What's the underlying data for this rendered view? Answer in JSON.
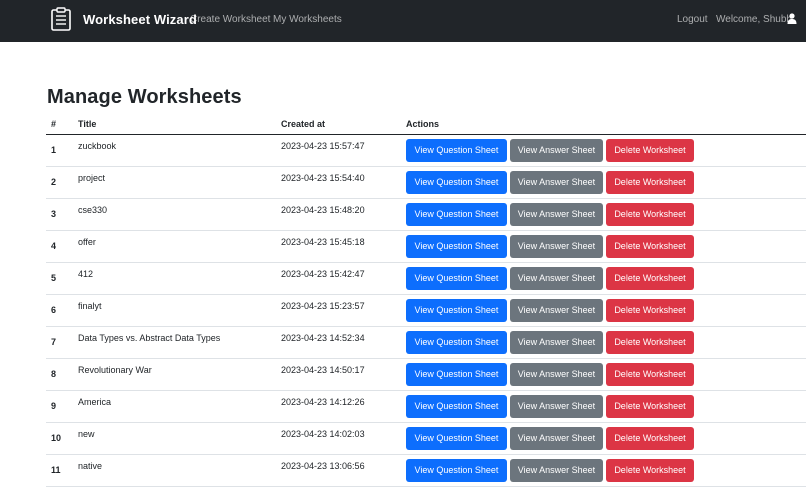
{
  "navbar": {
    "brand": "Worksheet Wizard",
    "links": [
      "Create Worksheet",
      "My Worksheets"
    ],
    "logout": "Logout",
    "welcome": "Welcome, Shubh",
    "icons": {
      "logo": "worksheet-logo-icon",
      "user": "user-icon"
    }
  },
  "page": {
    "title": "Manage Worksheets"
  },
  "table": {
    "headers": [
      "#",
      "Title",
      "Created at",
      "Actions"
    ],
    "action_labels": {
      "view_question": "View Question Sheet",
      "view_answer": "View Answer Sheet",
      "delete": "Delete Worksheet"
    },
    "rows": [
      {
        "num": "1",
        "title": "zuckbook",
        "created": "2023-04-23 15:57:47"
      },
      {
        "num": "2",
        "title": "project",
        "created": "2023-04-23 15:54:40"
      },
      {
        "num": "3",
        "title": "cse330",
        "created": "2023-04-23 15:48:20"
      },
      {
        "num": "4",
        "title": "offer",
        "created": "2023-04-23 15:45:18"
      },
      {
        "num": "5",
        "title": "412",
        "created": "2023-04-23 15:42:47"
      },
      {
        "num": "6",
        "title": "finalyt",
        "created": "2023-04-23 15:23:57"
      },
      {
        "num": "7",
        "title": "Data Types vs. Abstract Data Types",
        "created": "2023-04-23 14:52:34"
      },
      {
        "num": "8",
        "title": "Revolutionary War",
        "created": "2023-04-23 14:50:17"
      },
      {
        "num": "9",
        "title": "America",
        "created": "2023-04-23 14:12:26"
      },
      {
        "num": "10",
        "title": "new",
        "created": "2023-04-23 14:02:03"
      },
      {
        "num": "11",
        "title": "native",
        "created": "2023-04-23 13:06:56"
      }
    ]
  },
  "colors": {
    "navbar_bg": "#212529",
    "primary": "#0d6efd",
    "secondary": "#6c757d",
    "danger": "#dc3545"
  }
}
